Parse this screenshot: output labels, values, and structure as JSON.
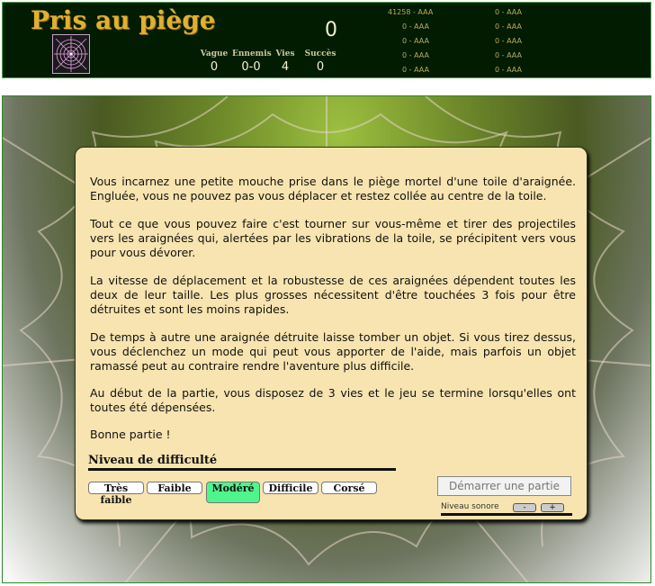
{
  "header": {
    "title": "Pris au piège",
    "score": "0",
    "stats": [
      {
        "label": "Vague",
        "value": "0"
      },
      {
        "label": "Ennemis",
        "value": "0-0"
      },
      {
        "label": "Vies",
        "value": "4"
      },
      {
        "label": "Succès",
        "value": "0"
      }
    ],
    "highscores_left": [
      "41258 - AAA",
      "0 - AAA",
      "0 - AAA",
      "0 - AAA",
      "0 - AAA"
    ],
    "highscores_right": [
      "0 - AAA",
      "0 - AAA",
      "0 - AAA",
      "0 - AAA",
      "0 - AAA"
    ]
  },
  "intro": {
    "paragraphs": [
      "Vous incarnez une petite mouche prise dans le piège mortel d'une toile d'araignée. Engluée, vous ne pouvez pas vous déplacer et restez collée au centre de la toile.",
      "Tout ce que vous pouvez faire c'est tourner sur vous-même et tirer des projectiles vers les araignées qui, alertées par les vibrations de la toile, se précipitent vers vous pour vous dévorer.",
      "La vitesse de déplacement et la robustesse de ces araignées dépendent toutes les deux de leur taille. Les plus grosses nécessitent d'être touchées 3 fois pour être détruites et sont les moins rapides.",
      "De temps à autre une araignée détruite laisse tomber un objet. Si vous tirez dessus, vous déclenchez un mode qui peut vous apporter de l'aide, mais parfois un objet ramassé peut au contraire rendre l'aventure plus difficile.",
      "Au début de la partie, vous disposez de 3 vies et le jeu se termine lorsqu'elles ont toutes été dépensées.",
      "Bonne partie !"
    ]
  },
  "difficulty": {
    "title": "Niveau de difficulté",
    "options": [
      "Très faible",
      "Faible",
      "Modéré",
      "Difficile",
      "Corsé"
    ],
    "selected": "Modéré",
    "selected_color": "#4df58c"
  },
  "start_label": "Démarrer une partie",
  "sound": {
    "label": "Niveau sonore",
    "minus": "-",
    "plus": "+"
  },
  "colors": {
    "title": "#e0b030",
    "header_bg": "#021c02",
    "panel_bg": "#f8e4b0"
  }
}
